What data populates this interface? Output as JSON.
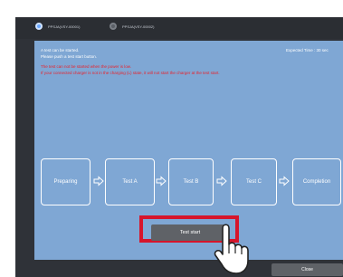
{
  "radio": {
    "option1": "PPSJA(VSY-00001)",
    "option2": "PPSJA(VSY-00002)"
  },
  "messages": {
    "line1": "A test can be started.",
    "line2": "Please push a test start button.",
    "warn1": "The test can not be started when the power is low.",
    "warn2": "If your connected charger is not in the charging (L) state, it will not start the charger at the test start."
  },
  "expected_time": "Expected Time : 30 sec",
  "steps": [
    "Preparing",
    "Test A",
    "Test B",
    "Test C",
    "Completion"
  ],
  "buttons": {
    "test_start": "Test start",
    "close": "Close"
  },
  "colors": {
    "panel": "#7fa7d4",
    "highlight": "#d6152b",
    "button": "#5f6267"
  }
}
